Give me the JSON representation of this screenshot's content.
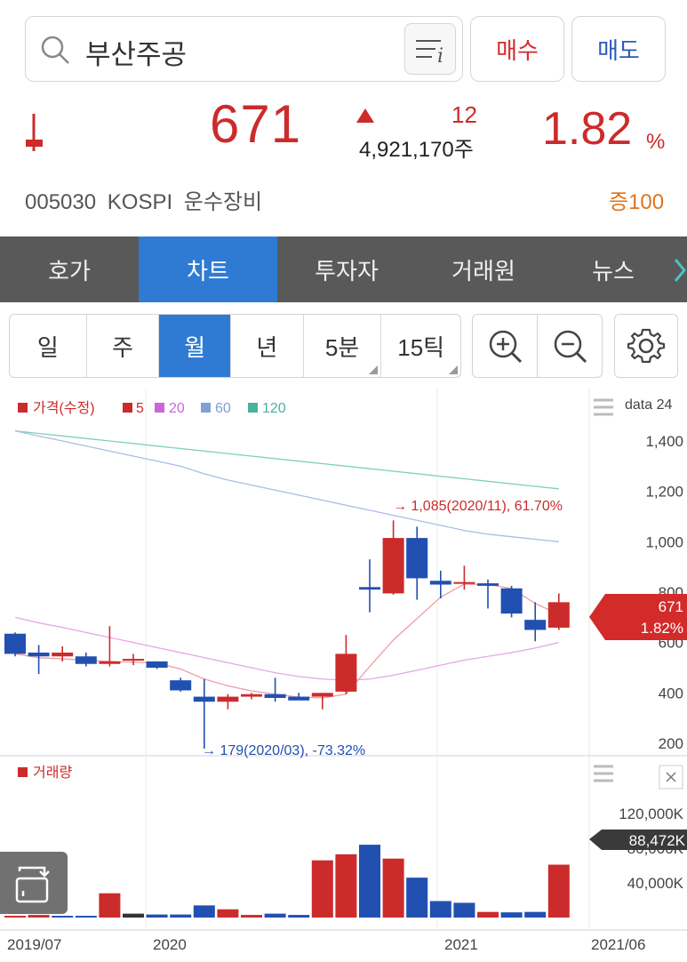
{
  "search": {
    "value": "부산주공"
  },
  "buttons": {
    "buy": "매수",
    "sell": "매도"
  },
  "quote": {
    "price": "671",
    "change": "12",
    "volume": "4,921,170주",
    "rate": "1.82",
    "rate_unit": "%",
    "code": "005030",
    "market": "KOSPI",
    "sector": "운수장비",
    "margin": "증100"
  },
  "tabs": [
    "호가",
    "차트",
    "투자자",
    "거래원",
    "뉴스"
  ],
  "periods": [
    "일",
    "주",
    "월",
    "년",
    "5분",
    "15틱"
  ],
  "legend": {
    "price": "가격(수정)",
    "ma": [
      "5",
      "20",
      "60",
      "120"
    ],
    "data_label": "data 24",
    "volume": "거래량"
  },
  "annotations": {
    "high": "1,085(2020/11), 61.70%",
    "low": "179(2020/03), -73.32%"
  },
  "price_tag": {
    "value": "671",
    "rate": "1.82%"
  },
  "volume_tag": "88,472K",
  "colors": {
    "up": "#cc2b2b",
    "down": "#2150b0",
    "accent": "#2f7bd3",
    "orange": "#e0751c"
  },
  "chart_data": [
    {
      "type": "candlestick",
      "title": "가격(수정)",
      "yticks": [
        "1,400",
        "1,200",
        "1,000",
        "800",
        "600",
        "400",
        "200"
      ],
      "ylim": [
        150,
        1500
      ],
      "xticks": [
        "2019/07",
        "2020",
        "2021",
        "2021/06"
      ],
      "candles": [
        {
          "o": 635,
          "h": 640,
          "l": 545,
          "c": 555
        },
        {
          "o": 560,
          "h": 590,
          "l": 475,
          "c": 545
        },
        {
          "o": 545,
          "h": 585,
          "l": 525,
          "c": 560
        },
        {
          "o": 545,
          "h": 560,
          "l": 505,
          "c": 515
        },
        {
          "o": 515,
          "h": 665,
          "l": 505,
          "c": 525
        },
        {
          "o": 535,
          "h": 555,
          "l": 510,
          "c": 535
        },
        {
          "o": 525,
          "h": 525,
          "l": 495,
          "c": 500
        },
        {
          "o": 450,
          "h": 460,
          "l": 405,
          "c": 410
        },
        {
          "o": 385,
          "h": 455,
          "l": 179,
          "c": 365
        },
        {
          "o": 365,
          "h": 395,
          "l": 335,
          "c": 385
        },
        {
          "o": 385,
          "h": 400,
          "l": 375,
          "c": 395
        },
        {
          "o": 395,
          "h": 460,
          "l": 365,
          "c": 380
        },
        {
          "o": 385,
          "h": 400,
          "l": 375,
          "c": 370
        },
        {
          "o": 385,
          "h": 400,
          "l": 335,
          "c": 400
        },
        {
          "o": 405,
          "h": 630,
          "l": 395,
          "c": 555
        },
        {
          "o": 820,
          "h": 930,
          "l": 720,
          "c": 810
        },
        {
          "o": 795,
          "h": 1085,
          "l": 790,
          "c": 1015
        },
        {
          "o": 1015,
          "h": 1060,
          "l": 770,
          "c": 855
        },
        {
          "o": 845,
          "h": 885,
          "l": 775,
          "c": 830
        },
        {
          "o": 835,
          "h": 905,
          "l": 810,
          "c": 840
        },
        {
          "o": 835,
          "h": 850,
          "l": 735,
          "c": 825
        },
        {
          "o": 815,
          "h": 825,
          "l": 700,
          "c": 715
        },
        {
          "o": 690,
          "h": 760,
          "l": 605,
          "c": 650
        },
        {
          "o": 659,
          "h": 795,
          "l": 650,
          "c": 760
        }
      ],
      "ma5": [
        555,
        540,
        535,
        530,
        525,
        522,
        518,
        495,
        455,
        428,
        408,
        395,
        383,
        380,
        395,
        505,
        610,
        695,
        780,
        832,
        830,
        815,
        755,
        712
      ],
      "ma20": [
        700,
        678,
        660,
        640,
        620,
        600,
        580,
        560,
        540,
        520,
        500,
        480,
        465,
        455,
        450,
        455,
        470,
        490,
        510,
        530,
        545,
        560,
        578,
        600
      ],
      "ma60": [
        1440,
        1420,
        1400,
        1380,
        1360,
        1340,
        1320,
        1300,
        1270,
        1245,
        1225,
        1205,
        1185,
        1165,
        1145,
        1125,
        1105,
        1085,
        1065,
        1045,
        1030,
        1020,
        1010,
        1000
      ],
      "ma120": [
        1440,
        1430,
        1420,
        1410,
        1400,
        1390,
        1380,
        1370,
        1360,
        1350,
        1340,
        1330,
        1320,
        1310,
        1300,
        1290,
        1280,
        1270,
        1260,
        1250,
        1240,
        1230,
        1220,
        1210
      ]
    },
    {
      "type": "bar",
      "title": "거래량",
      "yticks": [
        "120,000K",
        "80,000K",
        "40,000K"
      ],
      "ylim": [
        0,
        160000
      ],
      "values": [
        2000,
        3000,
        2000,
        2000,
        28000,
        4500,
        3500,
        3500,
        14000,
        9500,
        3000,
        4500,
        3000,
        66000,
        73000,
        84000,
        68000,
        46000,
        19000,
        17000,
        6500,
        6000,
        6500,
        61000
      ],
      "colors": [
        "up",
        "up",
        "down",
        "down",
        "up",
        "black",
        "down",
        "down",
        "down",
        "up",
        "up",
        "down",
        "down",
        "up",
        "up",
        "down",
        "up",
        "down",
        "down",
        "down",
        "up",
        "down",
        "down",
        "up"
      ]
    }
  ]
}
